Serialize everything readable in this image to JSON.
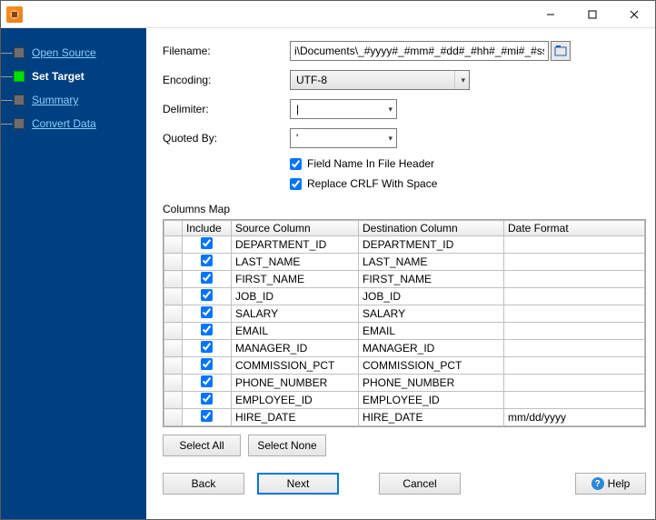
{
  "sidebar": {
    "items": [
      {
        "label": "Open Source",
        "active": false
      },
      {
        "label": "Set Target",
        "active": true
      },
      {
        "label": "Summary",
        "active": false
      },
      {
        "label": "Convert Data",
        "active": false
      }
    ]
  },
  "form": {
    "filename": {
      "label": "Filename:",
      "value": "i\\Documents\\_#yyyy#_#mm#_#dd#_#hh#_#mi#_#ss#.txt"
    },
    "encoding": {
      "label": "Encoding:",
      "value": "UTF-8"
    },
    "delimiter": {
      "label": "Delimiter:",
      "value": "|"
    },
    "quoted_by": {
      "label": "Quoted By:",
      "value": "'"
    },
    "field_name_in_header": {
      "label": "Field Name In File Header",
      "checked": true
    },
    "replace_crlf": {
      "label": "Replace CRLF With Space",
      "checked": true
    }
  },
  "columns": {
    "title": "Columns Map",
    "headers": [
      "Include",
      "Source Column",
      "Destination Column",
      "Date Format"
    ],
    "rows": [
      {
        "include": true,
        "source": "DEPARTMENT_ID",
        "destination": "DEPARTMENT_ID",
        "date_format": ""
      },
      {
        "include": true,
        "source": "LAST_NAME",
        "destination": "LAST_NAME",
        "date_format": ""
      },
      {
        "include": true,
        "source": "FIRST_NAME",
        "destination": "FIRST_NAME",
        "date_format": ""
      },
      {
        "include": true,
        "source": "JOB_ID",
        "destination": "JOB_ID",
        "date_format": ""
      },
      {
        "include": true,
        "source": "SALARY",
        "destination": "SALARY",
        "date_format": ""
      },
      {
        "include": true,
        "source": "EMAIL",
        "destination": "EMAIL",
        "date_format": ""
      },
      {
        "include": true,
        "source": "MANAGER_ID",
        "destination": "MANAGER_ID",
        "date_format": ""
      },
      {
        "include": true,
        "source": "COMMISSION_PCT",
        "destination": "COMMISSION_PCT",
        "date_format": ""
      },
      {
        "include": true,
        "source": "PHONE_NUMBER",
        "destination": "PHONE_NUMBER",
        "date_format": ""
      },
      {
        "include": true,
        "source": "EMPLOYEE_ID",
        "destination": "EMPLOYEE_ID",
        "date_format": ""
      },
      {
        "include": true,
        "source": "HIRE_DATE",
        "destination": "HIRE_DATE",
        "date_format": "mm/dd/yyyy"
      }
    ]
  },
  "buttons": {
    "select_all": "Select All",
    "select_none": "Select None",
    "back": "Back",
    "next": "Next",
    "cancel": "Cancel",
    "help": "Help"
  }
}
